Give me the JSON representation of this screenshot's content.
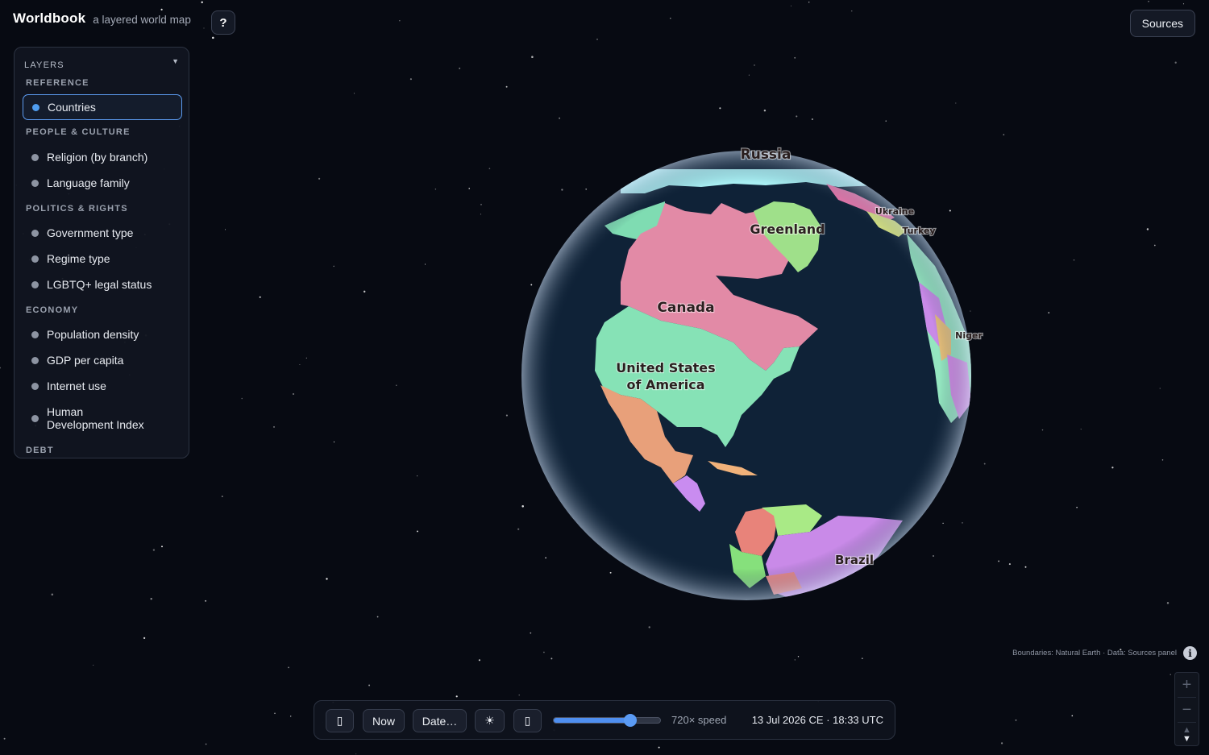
{
  "app": {
    "title": "Worldbook",
    "subtitle": "a layered world map"
  },
  "header": {
    "help_label": "?",
    "sources_label": "Sources"
  },
  "layers_panel": {
    "title": "LAYERS",
    "collapse_icon": "chevron-down-icon",
    "sections": [
      {
        "title": "REFERENCE",
        "items": [
          {
            "label": "Countries",
            "active": true
          }
        ]
      },
      {
        "title": "PEOPLE & CULTURE",
        "items": [
          {
            "label": "Religion (by branch)"
          },
          {
            "label": "Language family"
          }
        ]
      },
      {
        "title": "POLITICS & RIGHTS",
        "items": [
          {
            "label": "Government type"
          },
          {
            "label": "Regime type"
          },
          {
            "label": "LGBTQ+ legal status"
          }
        ]
      },
      {
        "title": "ECONOMY",
        "items": [
          {
            "label": "Population density"
          },
          {
            "label": "GDP per capita"
          },
          {
            "label": "Internet use"
          },
          {
            "label": "Human Development Index"
          }
        ]
      },
      {
        "title": "DEBT",
        "items": []
      }
    ]
  },
  "globe": {
    "ocean_color": "#0f2237",
    "country_labels": [
      "Russia",
      "Greenland",
      "Ukraine",
      "Turkey",
      "Canada",
      "Niger",
      "United States",
      "of America",
      "Brazil"
    ]
  },
  "attribution": "Boundaries: Natural Earth · Data: Sources panel",
  "zoom": {
    "zoom_in_icon": "plus-icon",
    "zoom_out_icon": "minus-icon",
    "compass_icon": "compass-icon"
  },
  "time_bar": {
    "play_button": "▯",
    "now_label": "Now",
    "date_label": "Date…",
    "sun_button": "☀",
    "box_button": "▯",
    "speed_fraction": 0.72,
    "speed_label": "720× speed",
    "datetime": "13 Jul 2026 CE · 18:33 UTC"
  },
  "colors": {
    "accent": "#4f9df0",
    "background": "#070a12",
    "panel": "#111520"
  }
}
